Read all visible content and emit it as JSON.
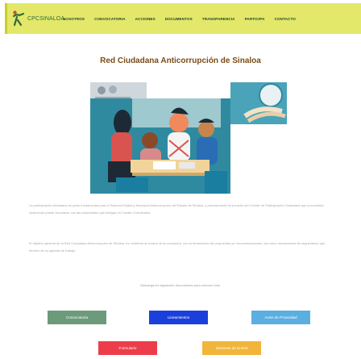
{
  "header": {
    "logo_text": "CPCSINALOA",
    "nav": [
      "NOSOTROS",
      "CONVOCATORIA",
      "ACCIONES",
      "DOCUMENTOS",
      "TRANSPARENCIA",
      "PARTICIPA",
      "CONTACTO"
    ]
  },
  "page": {
    "title": "Red Ciudadana Anticorrupción de Sinaloa",
    "paragraph1": "La participación ciudadana es parte fundamental para el Sistema Estatal y Municipal Anticorrupción del Estado de Sinaloa, y precisamente es a través del Comité de Participación Ciudadana que la sociedad sinaloense puede vincularse con las autoridades que integran el Comité Coordinador.",
    "paragraph2": "El objetivo general de la Red Ciudadana Anticorrupción de Sinaloa, es contribuir al control de la corrupción, con la formulación de propuestas y/o recomendaciones, así como mecanismos de seguimiento que deriven de su agenda de trabajo.",
    "downloads_note": "Descarga los siguientes documentos para conocer más:"
  },
  "buttons": {
    "convocatoria": "Convocatoria",
    "lineamientos": "Lineamientos",
    "aviso": "Aviso de Privacidad",
    "formulario": "Formulario",
    "sesiones": "Sesiones de la Red"
  },
  "colors": {
    "nav_bg": "#e3e86a",
    "title": "#7a4b17",
    "convocatoria": "#6b9b7a",
    "lineamientos": "#1b3fdc",
    "aviso": "#5aaee0",
    "formulario": "#ee3d4a",
    "sesiones": "#f0b53a"
  }
}
